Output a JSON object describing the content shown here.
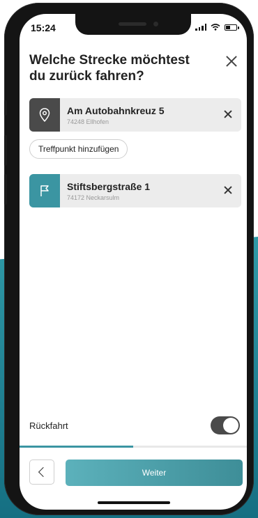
{
  "status_bar": {
    "time": "15:24",
    "icons": [
      "signal-icon",
      "wifi-icon",
      "battery-icon"
    ]
  },
  "header": {
    "title": "Welche Strecke möchtest du zurück fahren?",
    "close_icon": "close-icon"
  },
  "start": {
    "icon": "location-pin-icon",
    "icon_bg": "#4a4a4a",
    "street": "Am Autobahnkreuz 5",
    "city": "74248 Ellhofen",
    "remove_icon": "close-icon"
  },
  "add_stop": {
    "label": "Treffpunkt hinzufügen"
  },
  "destination": {
    "icon": "flag-icon",
    "icon_bg": "#3b95a2",
    "street": "Stiftsbergstraße 1",
    "city": "74172 Neckarsulm",
    "remove_icon": "close-icon"
  },
  "return_trip": {
    "label": "Rückfahrt",
    "enabled": true
  },
  "progress": {
    "fraction": 0.5,
    "color": "#3b95a2"
  },
  "footer": {
    "back_icon": "chevron-left-icon",
    "next_label": "Weiter"
  },
  "colors": {
    "accent": "#3b95a2",
    "background_teal": "#2f9aa7"
  }
}
